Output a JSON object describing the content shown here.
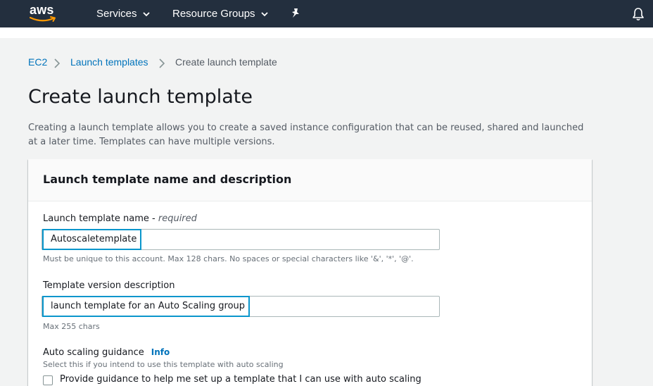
{
  "nav": {
    "logo_text": "aws",
    "services_label": "Services",
    "resource_groups_label": "Resource Groups"
  },
  "breadcrumb": {
    "items": [
      "EC2",
      "Launch templates"
    ],
    "current": "Create launch template"
  },
  "page": {
    "title": "Create launch template",
    "description": "Creating a launch template allows you to create a saved instance configuration that can be reused, shared and launched at a later time. Templates can have multiple versions."
  },
  "card": {
    "title": "Launch template name and description",
    "name_field": {
      "label": "Launch template name - ",
      "label_required": "required",
      "value": "Autoscaletemplate",
      "hint": "Must be unique to this account. Max 128 chars. No spaces or special characters like '&', '*', '@'."
    },
    "version_field": {
      "label": "Template version description",
      "value": "launch template for an Auto Scaling group",
      "hint": "Max 255 chars"
    },
    "auto_scaling": {
      "label": "Auto scaling guidance",
      "info_label": "Info",
      "hint": "Select this if you intend to use this template with auto scaling",
      "checkbox_label": "Provide guidance to help me set up a template that I can use with auto scaling",
      "checked": false
    }
  },
  "colors": {
    "nav_bg": "#232f3e",
    "link": "#0073bb",
    "focus": "#0a96cc",
    "smile": "#ff9900"
  }
}
